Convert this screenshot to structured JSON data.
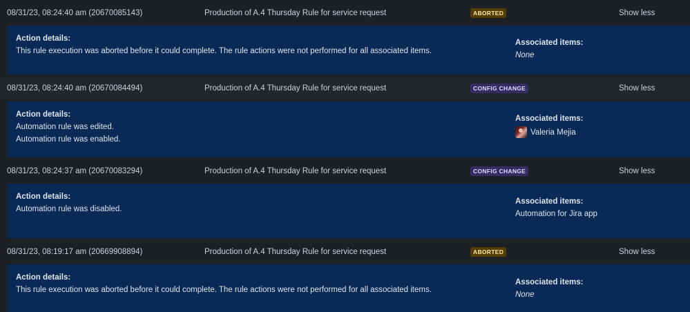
{
  "entries": [
    {
      "timestamp": "08/31/23, 08:24:40 am (20670085143)",
      "rule": "Production of A.4 Thursday Rule for service request",
      "badge": "ABORTED",
      "toggle": "Show less",
      "details_heading": "Action details:",
      "details": [
        "This rule execution was aborted before it could complete. The rule actions were not performed for all associated items."
      ],
      "assoc_heading": "Associated items:",
      "assoc_value": "None"
    },
    {
      "timestamp": "08/31/23, 08:24:40 am (20670084494)",
      "rule": "Production of A.4 Thursday Rule for service request",
      "badge": "CONFIG CHANGE",
      "toggle": "Show less",
      "details_heading": "Action details:",
      "details": [
        "Automation rule was edited.",
        "Automation rule was enabled."
      ],
      "assoc_heading": "Associated items:",
      "assoc_value": "Valeria Mejia"
    },
    {
      "timestamp": "08/31/23, 08:24:37 am (20670083294)",
      "rule": "Production of A.4 Thursday Rule for service request",
      "badge": "CONFIG CHANGE",
      "toggle": "Show less",
      "details_heading": "Action details:",
      "details": [
        "Automation rule was disabled."
      ],
      "assoc_heading": "Associated items:",
      "assoc_value": "Automation for Jira app"
    },
    {
      "timestamp": "08/31/23, 08:19:17 am (20669908894)",
      "rule": "Production of A.4 Thursday Rule for service request",
      "badge": "ABORTED",
      "toggle": "Show less",
      "details_heading": "Action details:",
      "details": [
        "This rule execution was aborted before it could complete. The rule actions were not performed for all associated items."
      ],
      "assoc_heading": "Associated items:",
      "assoc_value": "None"
    }
  ],
  "colors": {
    "page_bg": "#1d2125",
    "row_alt_bg": "#22272b",
    "panel_bg": "#092957",
    "aborted_badge_bg": "#533f04",
    "aborted_badge_text": "#f8e6a0",
    "config_badge_bg": "#352c63",
    "config_badge_text": "#dfd8fd"
  },
  "icons": {
    "user_avatar": "user-avatar-icon"
  }
}
